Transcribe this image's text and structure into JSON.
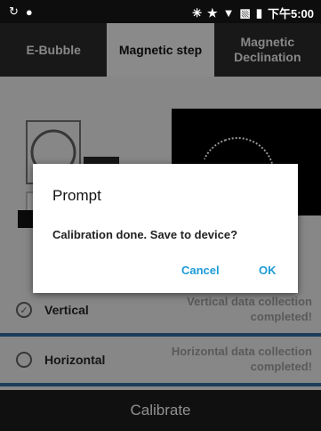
{
  "status_bar": {
    "time": "下午5:00",
    "left_icons": [
      "sync-icon",
      "location-icon"
    ],
    "right_icons": [
      "bluetooth-icon",
      "star-icon",
      "signal-icon",
      "no-sim-icon",
      "battery-icon"
    ]
  },
  "tabs": [
    {
      "label": "E-Bubble",
      "active": false
    },
    {
      "label": "Magnetic step",
      "active": true
    },
    {
      "label": "Magnetic Declination",
      "active": false
    }
  ],
  "rows": {
    "vertical": {
      "label": "Vertical",
      "status": "Vertical data collection completed!",
      "checked": true
    },
    "horizontal": {
      "label": "Horizontal",
      "status": "Horizontal data collection completed!",
      "checked": false
    }
  },
  "calibrate_label": "Calibrate",
  "dialog": {
    "title": "Prompt",
    "message": "Calibration done. Save to device?",
    "cancel": "Cancel",
    "ok": "OK"
  },
  "colors": {
    "accent": "#1e9bd7",
    "row_divider": "#2e5e8c"
  }
}
